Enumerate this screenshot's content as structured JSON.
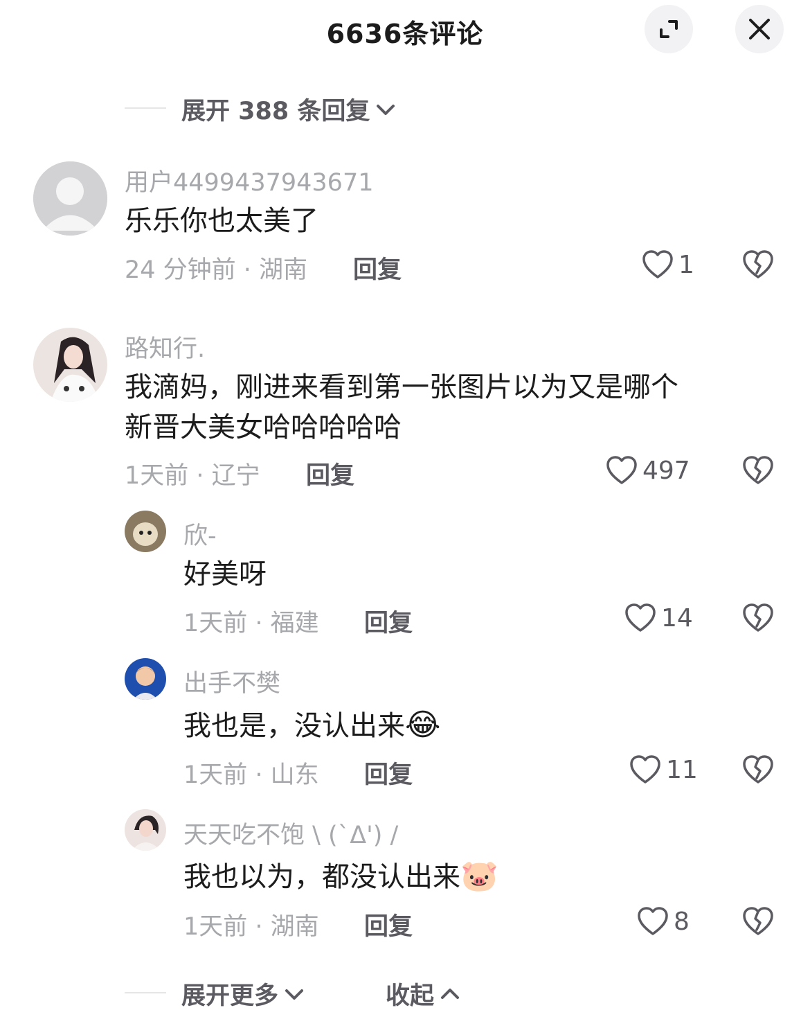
{
  "header": {
    "title": "6636条评论"
  },
  "top_expander": {
    "label": "展开 388 条回复"
  },
  "comments": [
    {
      "username": "用户4499437943671",
      "content": "乐乐你也太美了",
      "meta": "24 分钟前 · 湖南",
      "reply_label": "回复",
      "likes": "1"
    },
    {
      "username": "路知行.",
      "content_line1": "我滴妈，刚进来看到第一张图片以为又是哪个",
      "content_line2": "新晋大美女哈哈哈哈哈",
      "meta": "1天前 · 辽宁",
      "reply_label": "回复",
      "likes": "497"
    }
  ],
  "replies": [
    {
      "username": "欣-",
      "content": "好美呀",
      "meta": "1天前 · 福建",
      "reply_label": "回复",
      "likes": "14"
    },
    {
      "username": "出手不樊",
      "content": "我也是，没认出来",
      "emoji": "😂",
      "meta": "1天前 · 山东",
      "reply_label": "回复",
      "likes": "11"
    },
    {
      "username": "天天吃不饱 \\ (`Δ') /",
      "content": "我也以为，都没认出来",
      "emoji": "🐷",
      "meta": "1天前 · 湖南",
      "reply_label": "回复",
      "likes": "8"
    }
  ],
  "bottom": {
    "expand_more": "展开更多",
    "collapse": "收起"
  },
  "icons": {
    "expand": "expand-icon",
    "close": "close-icon",
    "like": "heart-icon",
    "dislike": "broken-heart-icon",
    "chevron": "chevron-down-icon"
  }
}
